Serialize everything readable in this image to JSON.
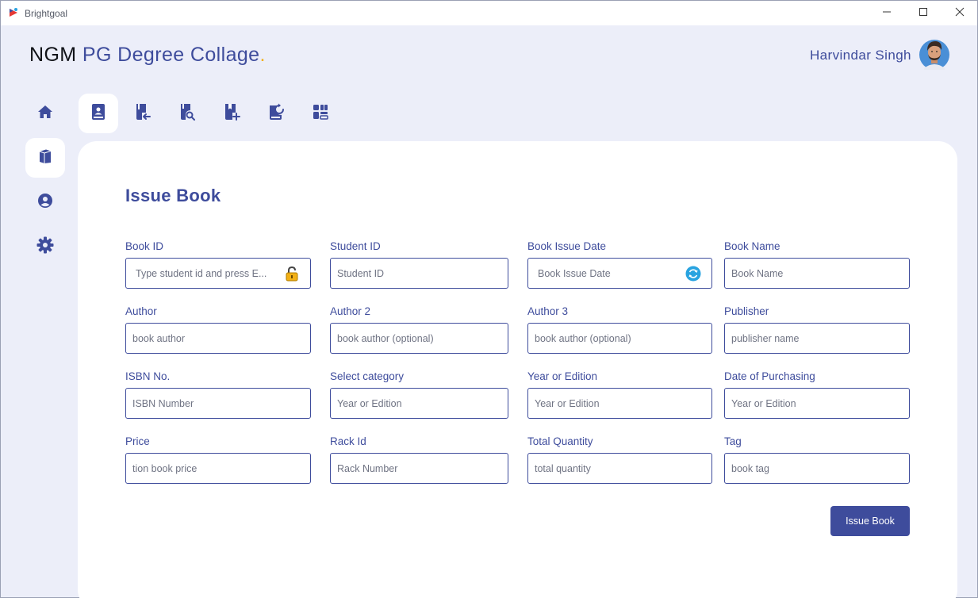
{
  "window": {
    "title": "Brightgoal",
    "controls": [
      "minimize-icon",
      "maximize-icon",
      "close-icon"
    ]
  },
  "header": {
    "brand_bold": "NGM",
    "brand_rest": "PG Degree Collage",
    "brand_dot": ".",
    "user_name": "Harvindar Singh"
  },
  "sidebar": {
    "items": [
      {
        "icon": "home-icon",
        "active": false
      },
      {
        "icon": "book-icon",
        "active": true
      },
      {
        "icon": "user-circle-icon",
        "active": false
      },
      {
        "icon": "gear-icon",
        "active": false
      }
    ]
  },
  "toolbar": {
    "items": [
      {
        "icon": "issue-book-icon",
        "active": true
      },
      {
        "icon": "return-book-icon",
        "active": false
      },
      {
        "icon": "search-book-icon",
        "active": false
      },
      {
        "icon": "add-book-icon",
        "active": false
      },
      {
        "icon": "renew-book-icon",
        "active": false
      },
      {
        "icon": "book-list-icon",
        "active": false
      }
    ]
  },
  "form": {
    "title": "Issue Book",
    "fields": [
      {
        "label": "Book ID",
        "placeholder": "Type student id and press E...",
        "suffix_icon": "lock-icon"
      },
      {
        "label": "Student ID",
        "placeholder": "Student ID"
      },
      {
        "label": "Book Issue Date",
        "placeholder": "Book Issue Date",
        "suffix_icon": "refresh-icon"
      },
      {
        "label": "Book Name",
        "placeholder": "Book Name"
      },
      {
        "label": "Author",
        "placeholder": "book author"
      },
      {
        "label": "Author 2",
        "placeholder": "book author (optional)"
      },
      {
        "label": "Author 3",
        "placeholder": "book author (optional)"
      },
      {
        "label": "Publisher",
        "placeholder": "publisher name"
      },
      {
        "label": "ISBN No.",
        "placeholder": "ISBN Number"
      },
      {
        "label": "Select category",
        "placeholder": "Year or Edition"
      },
      {
        "label": "Year or Edition",
        "placeholder": "Year or Edition"
      },
      {
        "label": "Date of Purchasing",
        "placeholder": "Year or Edition"
      },
      {
        "label": "Price",
        "placeholder": "tion book price"
      },
      {
        "label": "Rack Id",
        "placeholder": "Rack Number"
      },
      {
        "label": "Total Quantity",
        "placeholder": "total quantity"
      },
      {
        "label": "Tag",
        "placeholder": "book tag"
      }
    ],
    "submit_label": "Issue Book"
  },
  "colors": {
    "accent": "#3e4c9c",
    "background": "#eceef9",
    "panel": "#ffffff",
    "brand_dot": "#f2b015",
    "lock": "#f2b015",
    "refresh": "#29a3e0"
  }
}
